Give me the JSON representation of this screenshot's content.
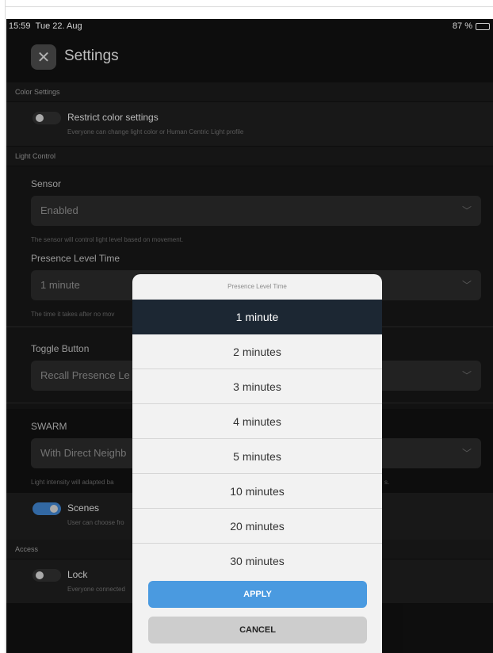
{
  "status": {
    "time": "15:59",
    "date": "Tue 22. Aug",
    "battery": "87 %",
    "battery_level": 0.87
  },
  "header": {
    "title": "Settings",
    "close_icon": "close-icon"
  },
  "color_settings": {
    "section": "Color Settings",
    "restrict": {
      "title": "Restrict color settings",
      "desc": "Everyone can change light color or Human Centric Light profile",
      "on": false
    }
  },
  "light_control": {
    "section": "Light Control",
    "sensor": {
      "label": "Sensor",
      "value": "Enabled",
      "helper": "The sensor will control light level based on movement."
    },
    "presence": {
      "label": "Presence Level Time",
      "value": "1 minute",
      "helper": "The time it takes after no mov"
    },
    "toggle_button": {
      "label": "Toggle Button",
      "value": "Recall Presence Le"
    },
    "swarm": {
      "label": "SWARM",
      "value": "With Direct Neighb",
      "helper_left": "Light intensity will adapted ba",
      "helper_right": "s."
    },
    "scenes": {
      "title": "Scenes",
      "desc": "User can choose fro",
      "on": true
    }
  },
  "access": {
    "section": "Access",
    "lock": {
      "title": "Lock",
      "desc": "Everyone connected",
      "on": false
    }
  },
  "modal": {
    "title": "Presence Level Time",
    "options": [
      {
        "label": "1 minute",
        "selected": true
      },
      {
        "label": "2 minutes",
        "selected": false
      },
      {
        "label": "3 minutes",
        "selected": false
      },
      {
        "label": "4 minutes",
        "selected": false
      },
      {
        "label": "5 minutes",
        "selected": false
      },
      {
        "label": "10 minutes",
        "selected": false
      },
      {
        "label": "20 minutes",
        "selected": false
      },
      {
        "label": "30 minutes",
        "selected": false
      }
    ],
    "apply": "APPLY",
    "cancel": "CANCEL"
  },
  "colors": {
    "accent": "#4a9ae0",
    "toggle_on": "#3d7fc7",
    "selected_option": "#1c2733",
    "background": "#111111"
  }
}
